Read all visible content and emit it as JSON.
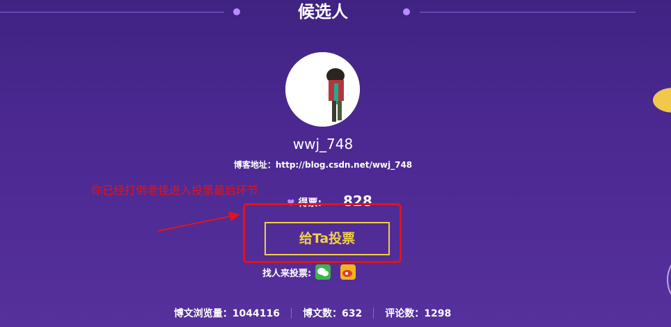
{
  "header": {
    "title": "候选人"
  },
  "candidate": {
    "username": "wwj_748",
    "blog_address": "博客地址：http://blog.csdn.net/wwj_748",
    "votes_label": "得票:",
    "votes_value": "828",
    "vote_button_label": "给Ta投票",
    "share_label": "找人来投票:"
  },
  "annotation": {
    "text": "你已经打倒老怪进入投票最后环节"
  },
  "stats": [
    {
      "label": "博文浏览量：1044116"
    },
    {
      "label": "博文数：632"
    },
    {
      "label": "评论数：1298"
    }
  ],
  "colors": {
    "background": "#4a2890",
    "accent_yellow": "#f2cf48",
    "annotation_red": "#e0141b"
  },
  "icons": [
    "heart-icon",
    "wechat-icon",
    "weibo-icon"
  ]
}
